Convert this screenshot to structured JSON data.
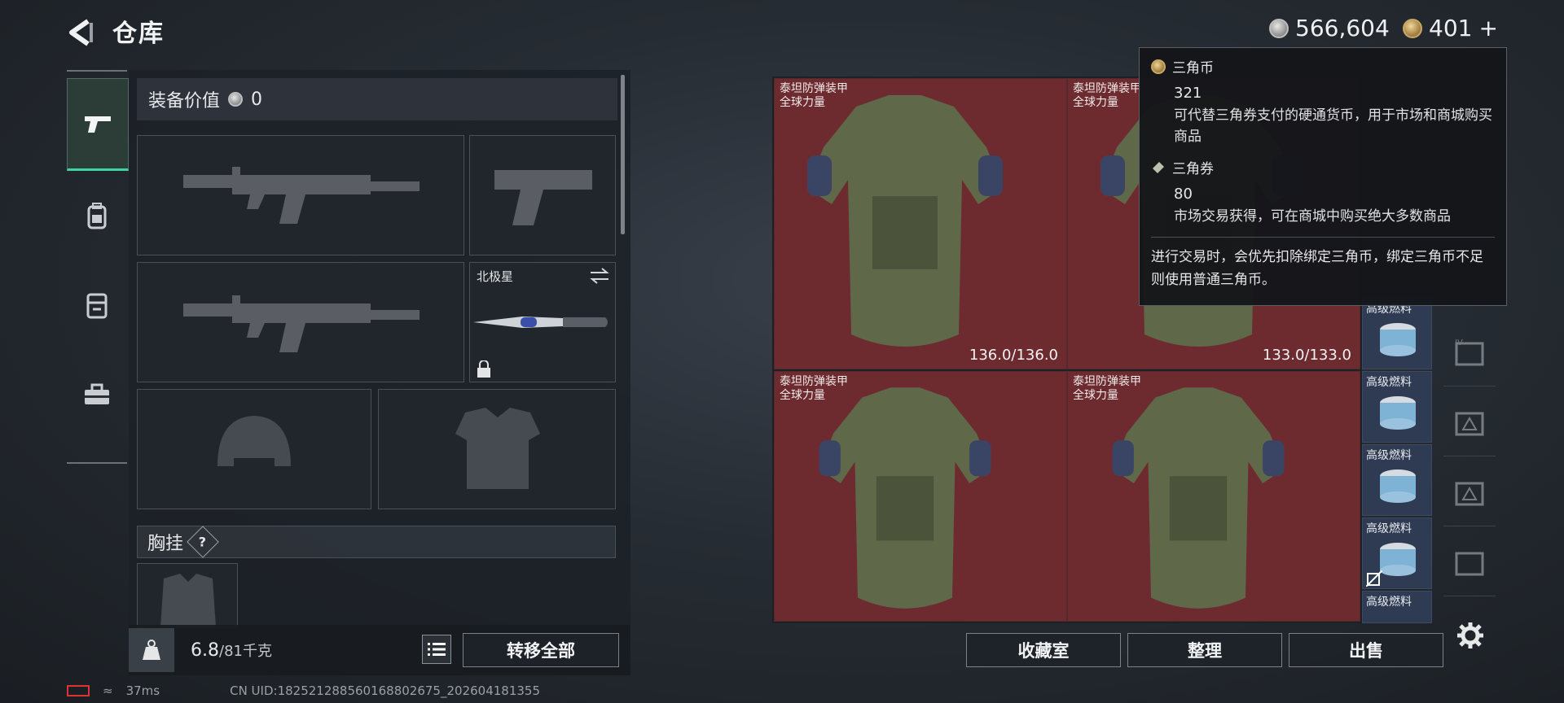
{
  "header": {
    "title": "仓库",
    "silver_amount": "566,604",
    "gold_amount": "401",
    "gold_plus": "+"
  },
  "left_panel": {
    "equip_value_label": "装备价值",
    "equip_value": "0",
    "melee_name": "北极星",
    "chest_rig_label": "胸挂",
    "chest_rig_help": "?",
    "weight_value": "6.8",
    "weight_capacity": "/81千克",
    "transfer_all_label": "转移全部"
  },
  "stash": {
    "items": [
      {
        "name": "泰坦防弹装甲",
        "sub": "全球力量",
        "durability": "136.0/136.0"
      },
      {
        "name": "泰坦防弹装甲",
        "sub": "全球力量",
        "durability": "133.0/133.0"
      },
      {
        "name": "泰坦防弹装甲",
        "sub": "全球力量",
        "durability": ""
      },
      {
        "name": "泰坦防弹装甲",
        "sub": "全球力量",
        "durability": ""
      }
    ],
    "fuel_label": "高级燃料",
    "buttons": {
      "collection": "收藏室",
      "organize": "整理",
      "sell": "出售"
    }
  },
  "tooltip": {
    "coin_name": "三角币",
    "coin_amount": "321",
    "coin_desc": "可代替三角券支付的硬通货币，用于市场和商城购买商品",
    "ticket_name": "三角券",
    "ticket_amount": "80",
    "ticket_desc": "市场交易获得，可在商城中购买绝大多数商品",
    "note": "进行交易时，会优先扣除绑定三角币，绑定三角币不足则使用普通三角币。"
  },
  "status": {
    "ping": "37ms",
    "uid": "CN UID:1825212885601688026​75_202604181355"
  },
  "colors": {
    "accent": "#3fd3a2",
    "item_bg": "#6d2b30",
    "fuel_bg": "#2e3b52"
  }
}
